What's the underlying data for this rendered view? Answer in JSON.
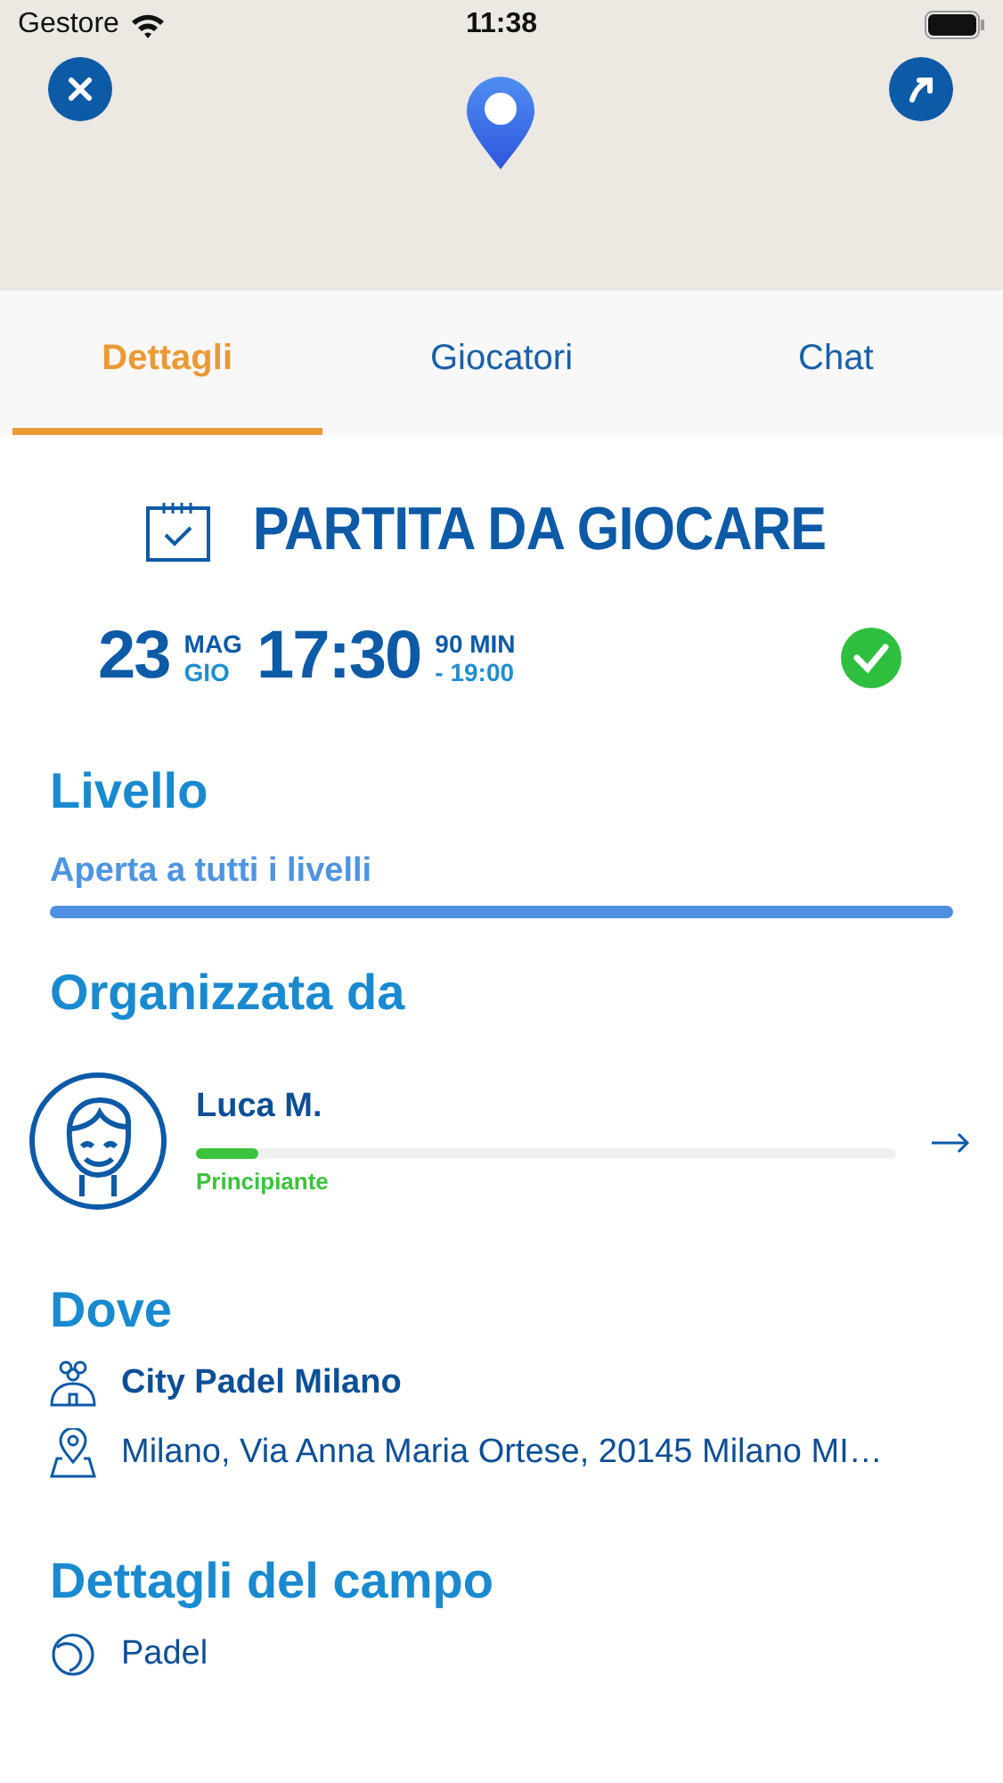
{
  "status_bar": {
    "carrier": "Gestore",
    "time": "11:38"
  },
  "tabs": [
    {
      "label": "Dettagli",
      "selected": true
    },
    {
      "label": "Giocatori",
      "selected": false
    },
    {
      "label": "Chat",
      "selected": false
    }
  ],
  "match": {
    "title": "PARTITA DA GIOCARE",
    "day": "23",
    "month": "MAG",
    "weekday": "GIO",
    "start": "17:30",
    "duration": "90 MIN",
    "end": "- 19:00",
    "confirmed": true
  },
  "level_section": {
    "heading": "Livello",
    "label": "Aperta a tutti i livelli",
    "level": 1
  },
  "organizer_section": {
    "heading": "Organizzata da",
    "name": "Luca M.",
    "level": 0.09,
    "level_label": "Principiante"
  },
  "where_section": {
    "heading": "Dove",
    "venue": "City Padel Milano",
    "address": "Milano, Via Anna Maria Ortese, 20145 Milano MI…"
  },
  "court_section": {
    "heading": "Dettagli del campo",
    "sport": "Padel"
  }
}
